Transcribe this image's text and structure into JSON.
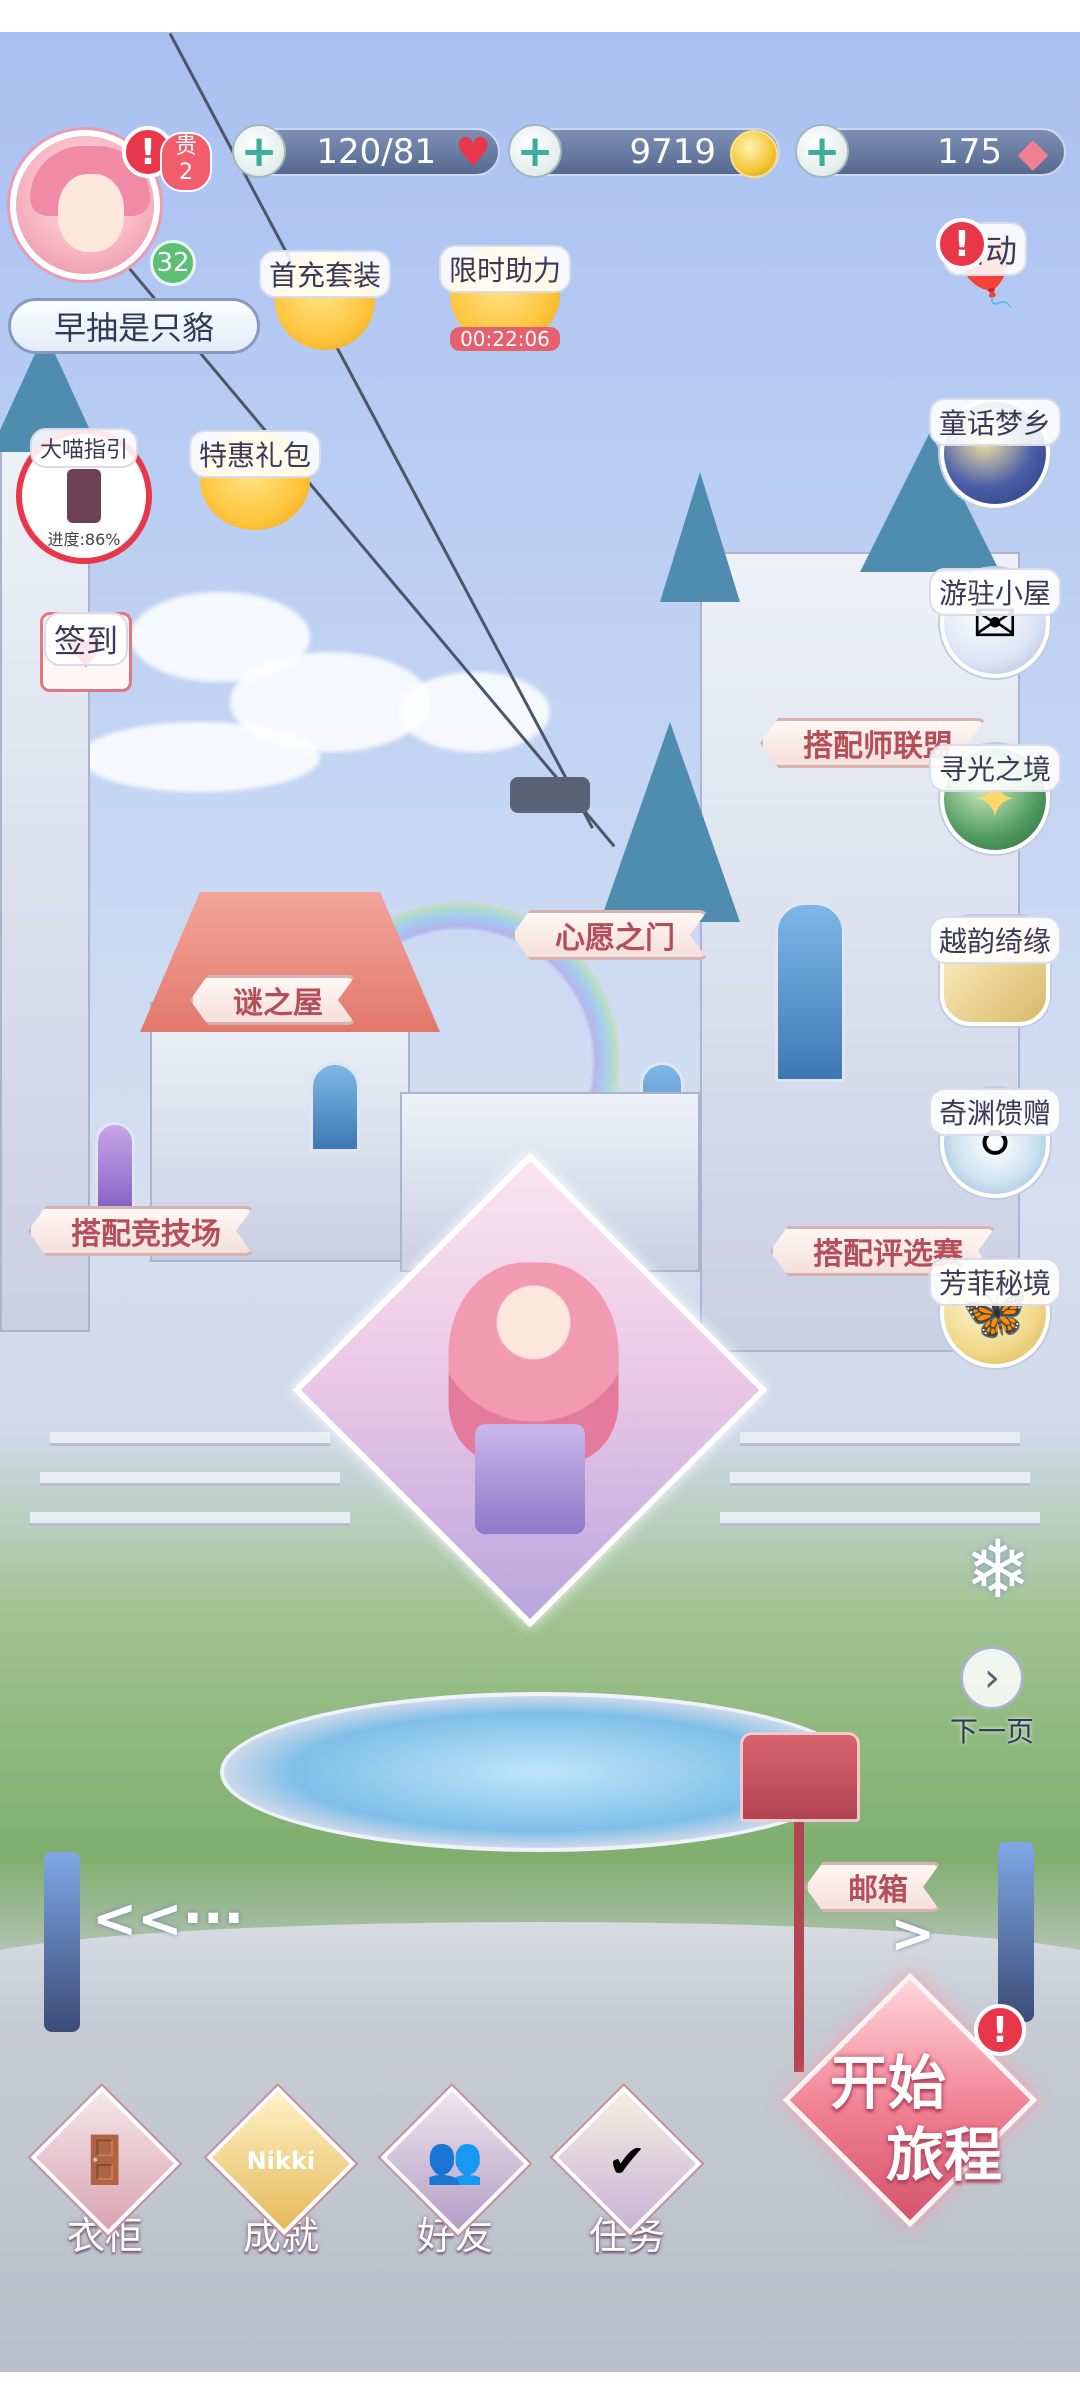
{
  "resources": {
    "stamina": "120/81",
    "gold": "9719",
    "diamonds": "175"
  },
  "player": {
    "name": "早抽是只貉",
    "level": "32",
    "vip_label": "贵",
    "vip_level": "2",
    "alert": "!"
  },
  "top_features": {
    "first_recharge": "首充套装",
    "limited_help": "限时助力",
    "limited_timer": "00:22:06",
    "special_pack": "特惠礼包"
  },
  "left_features": {
    "guide_progress": "进度:86%",
    "guide_label": "大喵指引",
    "checkin": "签到"
  },
  "right_features": [
    {
      "label": "活动",
      "alert": "!"
    },
    {
      "label": "童话梦乡"
    },
    {
      "label": "游驻小屋"
    },
    {
      "label": "寻光之境"
    },
    {
      "label": "越韵绮缘"
    },
    {
      "label": "奇渊馈赠"
    },
    {
      "label": "芳菲秘境"
    }
  ],
  "next_page": "下一页",
  "signposts": {
    "stylist_alliance": "搭配师联盟",
    "wish_gate": "心愿之门",
    "mystery_house": "谜之屋",
    "arena": "搭配竞技场",
    "judging": "搭配评选赛",
    "mailbox": "邮箱"
  },
  "bottom_nav": [
    {
      "label": "衣柜",
      "icon": "wardrobe-icon"
    },
    {
      "label": "成就",
      "icon": "medal-icon"
    },
    {
      "label": "好友",
      "icon": "friends-icon"
    },
    {
      "label": "任务",
      "icon": "task-icon"
    }
  ],
  "start_button": {
    "line1": "开始",
    "line2": "旅程",
    "alert": "!"
  },
  "nikki_badge": "Nikki",
  "colors": {
    "accent_pink": "#f07f92",
    "alert_red": "#e8374a",
    "level_green": "#5cbf76",
    "resource_bar": "#56698e"
  }
}
